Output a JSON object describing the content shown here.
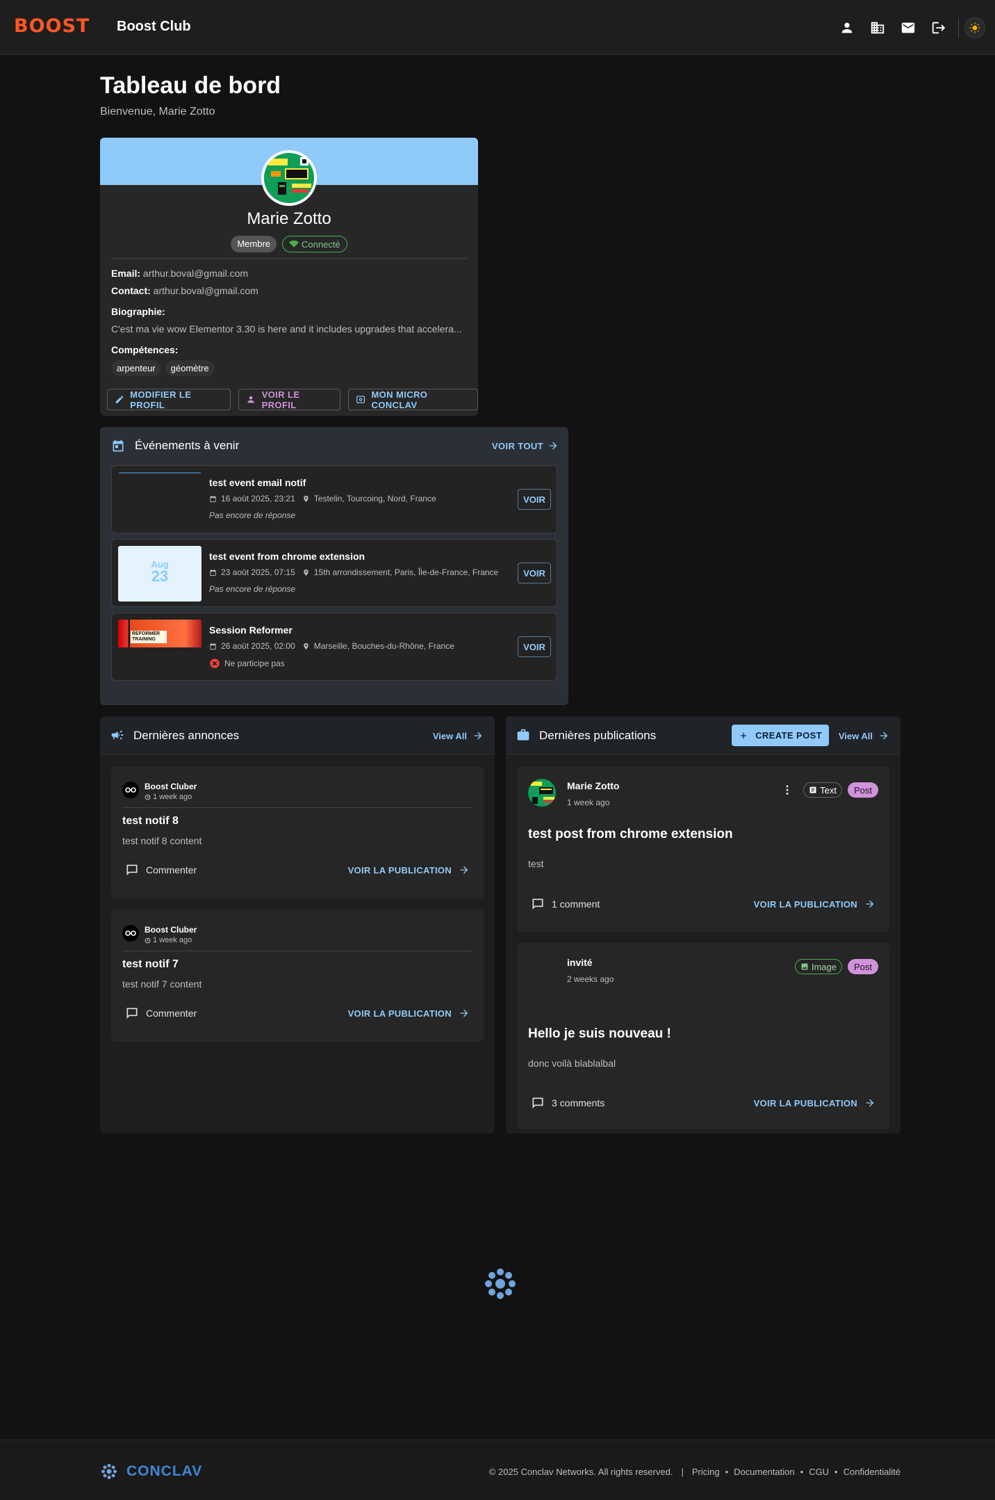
{
  "header": {
    "logo_text": "BOOST",
    "app_title": "Boost Club",
    "icons": [
      "person-icon",
      "building-icon",
      "mail-icon",
      "logout-icon",
      "sun-icon"
    ]
  },
  "page": {
    "title": "Tableau de bord",
    "subtitle": "Bienvenue, Marie Zotto"
  },
  "profile": {
    "name": "Marie Zotto",
    "role_chip": "Membre",
    "status_chip": "Connecté",
    "email_label": "Email:",
    "email": "arthur.boval@gmail.com",
    "contact_label": "Contact:",
    "contact": "arthur.boval@gmail.com",
    "bio_label": "Biographie:",
    "bio": "C'est ma vie wow Elementor 3.30 is here and it includes upgrades that accelera...",
    "skills_label": "Compétences:",
    "skills": [
      "arpenteur",
      "géomètre"
    ],
    "actions": {
      "edit": "MODIFIER LE PROFIL",
      "view": "VOIR LE PROFIL",
      "conclav": "MON MICRO CONCLAV"
    }
  },
  "events": {
    "title": "Événements à venir",
    "see_all": "VOIR TOUT",
    "view_label": "VOIR",
    "items": [
      {
        "title": "test event email notif",
        "date": "16 août 2025, 23:21",
        "location": "Testelin, Tourcoing, Nord, France",
        "status": "Pas encore de réponse"
      },
      {
        "title": "test event from chrome extension",
        "date": "23 août 2025, 07:15",
        "location": "15th arrondissement, Paris, Île-de-France, France",
        "status": "Pas encore de réponse",
        "thumb_month": "Aug",
        "thumb_day": "23"
      },
      {
        "title": "Session Reformer",
        "date": "26 août 2025, 02:00",
        "location": "Marseille, Bouches-du-Rhône, France",
        "status": "Ne participe pas",
        "thumb_text": "REFORMER TRAINING"
      }
    ]
  },
  "announcements": {
    "title": "Dernières annonces",
    "view_all": "View All",
    "comment_label": "Commenter",
    "see_publication": "VOIR LA PUBLICATION",
    "items": [
      {
        "author": "Boost Cluber",
        "time": "1 week ago",
        "title": "test notif 8",
        "content": "test notif 8 content"
      },
      {
        "author": "Boost Cluber",
        "time": "1 week ago",
        "title": "test notif 7",
        "content": "test notif 7 content"
      }
    ]
  },
  "publications": {
    "title": "Dernières publications",
    "create_post": "CREATE POST",
    "view_all": "View All",
    "see_publication": "VOIR LA PUBLICATION",
    "post_chip": "Post",
    "items": [
      {
        "author": "Marie Zotto",
        "time": "1 week ago",
        "type_chip": "Text",
        "title": "test post from chrome extension",
        "content": "test",
        "comments": "1 comment"
      },
      {
        "author": "invité",
        "time": "2 weeks ago",
        "type_chip": "Image",
        "title": "Hello je suis nouveau !",
        "content": "donc voilà blablalbal",
        "comments": "3 comments"
      }
    ]
  },
  "footer": {
    "brand": "CONCLAV",
    "copyright": "© 2025 Conclav Networks. All rights reserved.",
    "links": [
      "Pricing",
      "Documentation",
      "CGU",
      "Confidentialité"
    ]
  },
  "colors": {
    "accent_blue": "#90caf9",
    "accent_purple": "#ce93d8",
    "brand_orange": "#ff5722",
    "success_green": "#4caf50",
    "error_red": "#f44336"
  }
}
